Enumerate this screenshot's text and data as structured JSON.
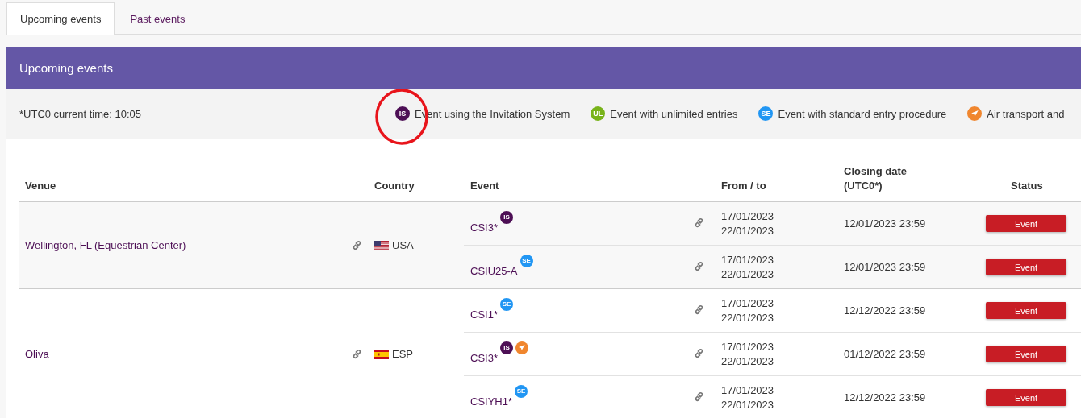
{
  "tabs": [
    {
      "label": "Upcoming events",
      "selected": true
    },
    {
      "label": "Past events",
      "selected": false
    }
  ],
  "panel": {
    "title": "Upcoming events",
    "current_time": "*UTC0 current time: 10:05",
    "legend": [
      {
        "kind": "IS",
        "badge": "IS",
        "label": "Event using the Invitation System"
      },
      {
        "kind": "UL",
        "badge": "UL",
        "label": "Event with unlimited entries"
      },
      {
        "kind": "SE",
        "badge": "SE",
        "label": "Event with standard entry procedure"
      },
      {
        "kind": "air",
        "label": "Air transport and"
      }
    ]
  },
  "table": {
    "columns": [
      "Venue",
      "Country",
      "Event",
      "From / to",
      "Closing date (UTC0*)",
      "Status"
    ],
    "rows": [
      {
        "venue": "Wellington, FL (Equestrian Center)",
        "country": "USA",
        "kind": "usa",
        "events": [
          {
            "name": "CSI3*",
            "badges": [
              {
                "kind": "IS",
                "text": "IS"
              }
            ],
            "from": "17/01/2023",
            "to": "22/01/2023",
            "closing": "12/01/2023 23:59",
            "status": "Event"
          },
          {
            "name": "CSIU25-A",
            "badges": [
              {
                "kind": "SE",
                "text": "SE"
              }
            ],
            "from": "17/01/2023",
            "to": "22/01/2023",
            "closing": "12/01/2023 23:59",
            "status": "Event"
          }
        ]
      },
      {
        "venue": "Oliva",
        "country": "ESP",
        "kind": "esp",
        "events": [
          {
            "name": "CSI1*",
            "badges": [
              {
                "kind": "SE",
                "text": "SE"
              }
            ],
            "from": "17/01/2023",
            "to": "22/01/2023",
            "closing": "12/12/2022 23:59",
            "status": "Event"
          },
          {
            "name": "CSI3*",
            "badges": [
              {
                "kind": "IS",
                "text": "IS"
              },
              {
                "kind": "air"
              }
            ],
            "from": "17/01/2023",
            "to": "22/01/2023",
            "closing": "01/12/2022 23:59",
            "status": "Event"
          },
          {
            "name": "CSIYH1*",
            "badges": [
              {
                "kind": "SE",
                "text": "SE"
              }
            ],
            "from": "17/01/2023",
            "to": "22/01/2023",
            "closing": "12/12/2022 23:59",
            "status": "Event"
          }
        ]
      }
    ]
  }
}
